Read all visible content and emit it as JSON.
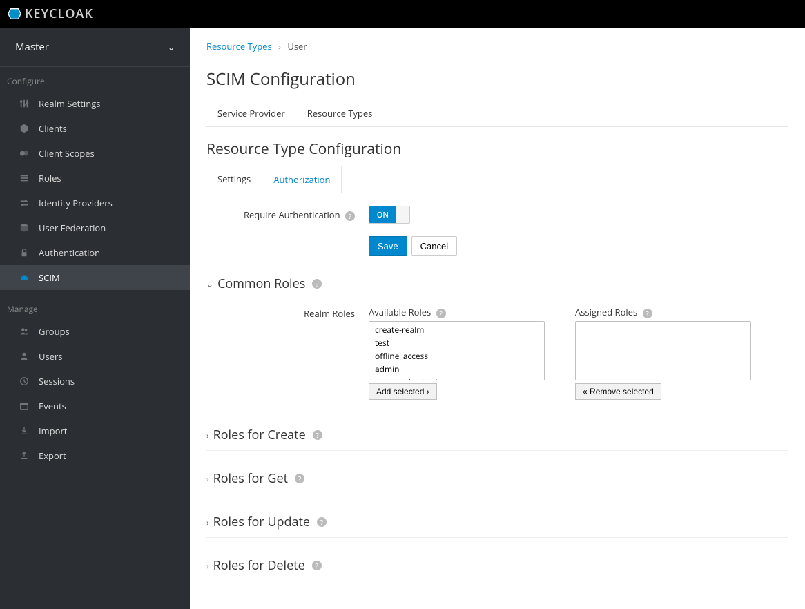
{
  "brand": "KEYCLOAK",
  "realm": "Master",
  "sidebar": {
    "configure_label": "Configure",
    "manage_label": "Manage",
    "configure": [
      {
        "label": "Realm Settings"
      },
      {
        "label": "Clients"
      },
      {
        "label": "Client Scopes"
      },
      {
        "label": "Roles"
      },
      {
        "label": "Identity Providers"
      },
      {
        "label": "User Federation"
      },
      {
        "label": "Authentication"
      },
      {
        "label": "SCIM"
      }
    ],
    "manage": [
      {
        "label": "Groups"
      },
      {
        "label": "Users"
      },
      {
        "label": "Sessions"
      },
      {
        "label": "Events"
      },
      {
        "label": "Import"
      },
      {
        "label": "Export"
      }
    ]
  },
  "breadcrumb": {
    "parent": "Resource Types",
    "current": "User"
  },
  "page_title": "SCIM Configuration",
  "top_tabs": {
    "service_provider": "Service Provider",
    "resource_types": "Resource Types"
  },
  "sub_title": "Resource Type Configuration",
  "sub_tabs": {
    "settings": "Settings",
    "authorization": "Authorization"
  },
  "form": {
    "require_auth_label": "Require Authentication",
    "toggle_on": "ON",
    "save": "Save",
    "cancel": "Cancel"
  },
  "sections": {
    "common": "Common Roles",
    "create": "Roles for Create",
    "get": "Roles for Get",
    "update": "Roles for Update",
    "delete": "Roles for Delete"
  },
  "roles": {
    "realm_label": "Realm Roles",
    "available_label": "Available Roles",
    "assigned_label": "Assigned Roles",
    "add_selected": "Add selected",
    "remove_selected": "Remove selected",
    "available": [
      "create-realm",
      "test",
      "offline_access",
      "admin",
      "uma_authorization"
    ],
    "assigned": []
  }
}
